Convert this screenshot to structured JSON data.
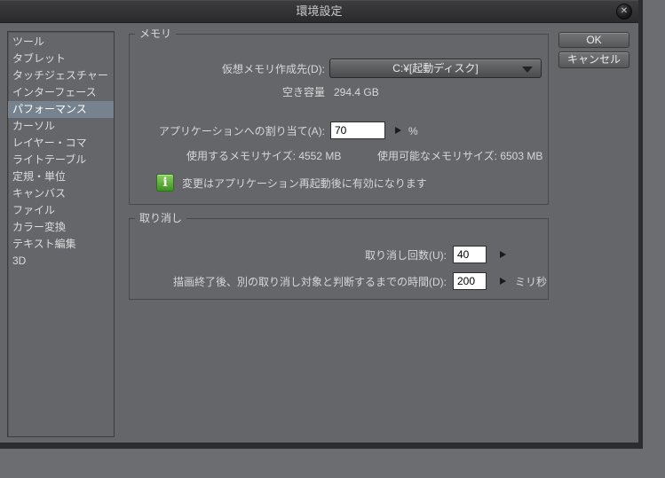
{
  "window": {
    "title": "環境設定",
    "close_icon": "✕"
  },
  "buttons": {
    "ok": "OK",
    "cancel": "キャンセル"
  },
  "sidebar": {
    "items": [
      {
        "label": "ツール",
        "selected": false
      },
      {
        "label": "タブレット",
        "selected": false
      },
      {
        "label": "タッチジェスチャー",
        "selected": false
      },
      {
        "label": "インターフェース",
        "selected": false
      },
      {
        "label": "パフォーマンス",
        "selected": true
      },
      {
        "label": "カーソル",
        "selected": false
      },
      {
        "label": "レイヤー・コマ",
        "selected": false
      },
      {
        "label": "ライトテーブル",
        "selected": false
      },
      {
        "label": "定規・単位",
        "selected": false
      },
      {
        "label": "キャンバス",
        "selected": false
      },
      {
        "label": "ファイル",
        "selected": false
      },
      {
        "label": "カラー変換",
        "selected": false
      },
      {
        "label": "テキスト編集",
        "selected": false
      },
      {
        "label": "3D",
        "selected": false
      }
    ]
  },
  "memory_section": {
    "title": "メモリ",
    "vm_label": "仮想メモリ作成先(D):",
    "vm_value": "C:¥[起動ディスク]",
    "free_label": "空き容量",
    "free_value": "294.4 GB",
    "alloc_label": "アプリケーションへの割り当て(A):",
    "alloc_value": "70",
    "alloc_unit": "%",
    "used_label": "使用するメモリサイズ:",
    "used_value": "4552 MB",
    "available_label": "使用可能なメモリサイズ:",
    "available_value": "6503 MB",
    "info_text": "変更はアプリケーション再起動後に有効になります"
  },
  "undo_section": {
    "title": "取り消し",
    "count_label": "取り消し回数(U):",
    "count_value": "40",
    "time_label": "描画終了後、別の取り消し対象と判断するまでの時間(D):",
    "time_value": "200",
    "time_unit": "ミリ秒"
  },
  "colors": {
    "dialog_bg": "#656669",
    "titlebar_bg": "#2f2f31",
    "selection": "#76828e",
    "info_green": "#4f9e33",
    "input_bg": "#ffffff"
  }
}
